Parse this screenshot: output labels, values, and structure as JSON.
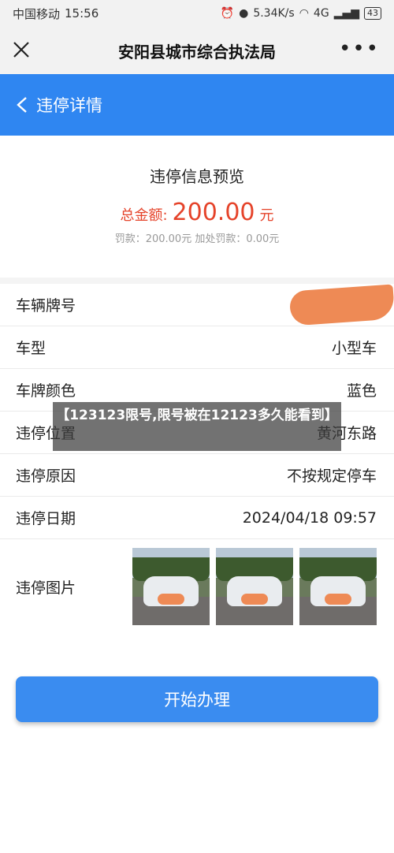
{
  "status_bar": {
    "carrier": "中国移动",
    "time": "15:56",
    "speed": "5.34K/s",
    "network": "4G",
    "battery": "43"
  },
  "titlebar": {
    "title": "安阳县城市综合执法局",
    "more": "•••"
  },
  "navbar": {
    "title": "违停详情"
  },
  "summary": {
    "heading": "违停信息预览",
    "total_label": "总金额:",
    "total_amount": "200.00",
    "total_unit": "元",
    "detail": "罚款：200.00元  加处罚款：0.00元"
  },
  "rows": [
    {
      "label": "车辆牌号",
      "value": ""
    },
    {
      "label": "车型",
      "value": "小型车"
    },
    {
      "label": "车牌颜色",
      "value": "蓝色"
    },
    {
      "label": "违停位置",
      "value": "黄河东路"
    },
    {
      "label": "违停原因",
      "value": "不按规定停车"
    },
    {
      "label": "违停日期",
      "value": "2024/04/18 09:57"
    },
    {
      "label": "违停图片",
      "value": ""
    }
  ],
  "action_button": "开始办理",
  "overlay_text": "【123123限号,限号被在12123多久能看到】",
  "colors": {
    "brand": "#2f86f1",
    "amount": "#e5432a",
    "button": "#3a8cf0"
  }
}
